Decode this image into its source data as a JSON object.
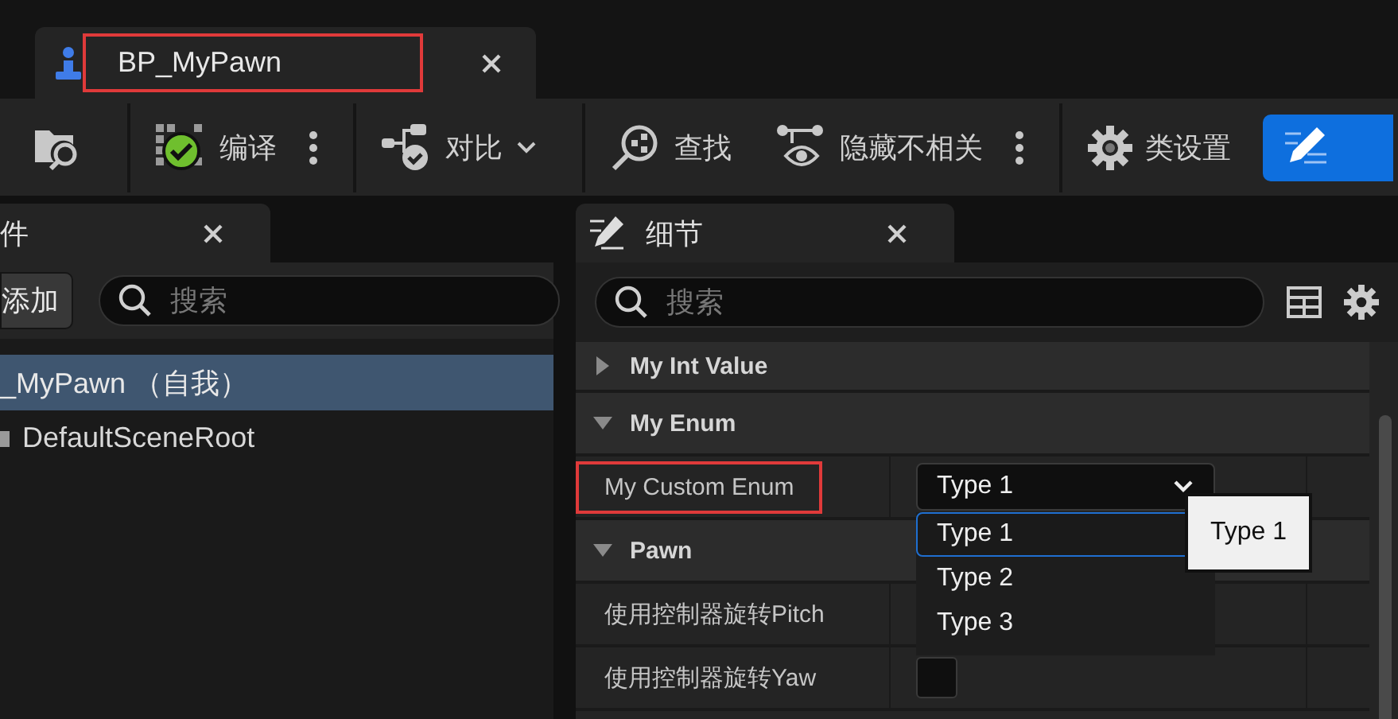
{
  "document_tab": {
    "title": "BP_MyPawn",
    "highlighted": true
  },
  "toolbar": {
    "items": [
      {
        "kind": "icon"
      },
      {
        "kind": "separator"
      },
      {
        "kind": "button",
        "label": "编译",
        "more": true
      },
      {
        "kind": "separator"
      },
      {
        "kind": "dropdown",
        "label": "对比"
      },
      {
        "kind": "separator"
      },
      {
        "kind": "button",
        "label": "查找"
      },
      {
        "kind": "button",
        "label": "隐藏不相关",
        "more": true
      },
      {
        "kind": "separator"
      },
      {
        "kind": "button",
        "label": "类设置"
      },
      {
        "kind": "icon",
        "selected": true
      }
    ]
  },
  "components_panel": {
    "tab": "件",
    "add_button": "添加",
    "search": {
      "placeholder": "搜索"
    },
    "tree": [
      {
        "label": "_MyPawn （自我）",
        "selected": true,
        "children": [
          {
            "label": "DefaultSceneRoot",
            "selected": false
          }
        ]
      }
    ]
  },
  "details_panel": {
    "tab": "细节",
    "search": {
      "placeholder": "搜索"
    },
    "categories": [
      {
        "name": "My Int Value",
        "expanded": false
      },
      {
        "name": "My Enum",
        "expanded": true,
        "properties": [
          {
            "label": "My Custom Enum",
            "highlighted": true,
            "kind": "combo",
            "value": "Type 1",
            "open": true,
            "options": [
              {
                "label": "Type 1",
                "selected": true
              },
              {
                "label": "Type 2",
                "selected": false
              },
              {
                "label": "Type 3",
                "selected": false
              }
            ],
            "tooltip": "Type 1"
          }
        ]
      },
      {
        "name": "Pawn",
        "expanded": true,
        "properties": [
          {
            "label": "使用控制器旋转Pitch",
            "highlighted": false
          },
          {
            "label": "使用控制器旋转Yaw",
            "highlighted": false,
            "kind": "checkbox",
            "checked": false
          }
        ]
      }
    ]
  }
}
